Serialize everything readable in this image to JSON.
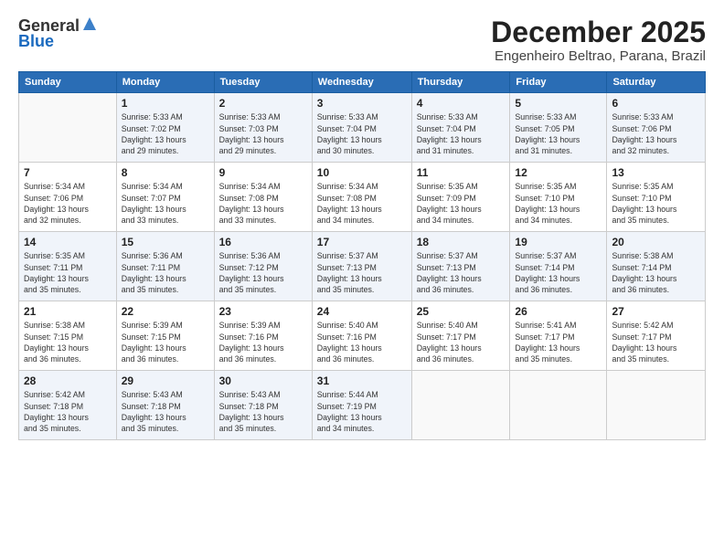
{
  "header": {
    "logo_general": "General",
    "logo_blue": "Blue",
    "title": "December 2025",
    "subtitle": "Engenheiro Beltrao, Parana, Brazil"
  },
  "calendar": {
    "days_of_week": [
      "Sunday",
      "Monday",
      "Tuesday",
      "Wednesday",
      "Thursday",
      "Friday",
      "Saturday"
    ],
    "weeks": [
      [
        {
          "day": "",
          "info": ""
        },
        {
          "day": "1",
          "info": "Sunrise: 5:33 AM\nSunset: 7:02 PM\nDaylight: 13 hours\nand 29 minutes."
        },
        {
          "day": "2",
          "info": "Sunrise: 5:33 AM\nSunset: 7:03 PM\nDaylight: 13 hours\nand 29 minutes."
        },
        {
          "day": "3",
          "info": "Sunrise: 5:33 AM\nSunset: 7:04 PM\nDaylight: 13 hours\nand 30 minutes."
        },
        {
          "day": "4",
          "info": "Sunrise: 5:33 AM\nSunset: 7:04 PM\nDaylight: 13 hours\nand 31 minutes."
        },
        {
          "day": "5",
          "info": "Sunrise: 5:33 AM\nSunset: 7:05 PM\nDaylight: 13 hours\nand 31 minutes."
        },
        {
          "day": "6",
          "info": "Sunrise: 5:33 AM\nSunset: 7:06 PM\nDaylight: 13 hours\nand 32 minutes."
        }
      ],
      [
        {
          "day": "7",
          "info": "Sunrise: 5:34 AM\nSunset: 7:06 PM\nDaylight: 13 hours\nand 32 minutes."
        },
        {
          "day": "8",
          "info": "Sunrise: 5:34 AM\nSunset: 7:07 PM\nDaylight: 13 hours\nand 33 minutes."
        },
        {
          "day": "9",
          "info": "Sunrise: 5:34 AM\nSunset: 7:08 PM\nDaylight: 13 hours\nand 33 minutes."
        },
        {
          "day": "10",
          "info": "Sunrise: 5:34 AM\nSunset: 7:08 PM\nDaylight: 13 hours\nand 34 minutes."
        },
        {
          "day": "11",
          "info": "Sunrise: 5:35 AM\nSunset: 7:09 PM\nDaylight: 13 hours\nand 34 minutes."
        },
        {
          "day": "12",
          "info": "Sunrise: 5:35 AM\nSunset: 7:10 PM\nDaylight: 13 hours\nand 34 minutes."
        },
        {
          "day": "13",
          "info": "Sunrise: 5:35 AM\nSunset: 7:10 PM\nDaylight: 13 hours\nand 35 minutes."
        }
      ],
      [
        {
          "day": "14",
          "info": "Sunrise: 5:35 AM\nSunset: 7:11 PM\nDaylight: 13 hours\nand 35 minutes."
        },
        {
          "day": "15",
          "info": "Sunrise: 5:36 AM\nSunset: 7:11 PM\nDaylight: 13 hours\nand 35 minutes."
        },
        {
          "day": "16",
          "info": "Sunrise: 5:36 AM\nSunset: 7:12 PM\nDaylight: 13 hours\nand 35 minutes."
        },
        {
          "day": "17",
          "info": "Sunrise: 5:37 AM\nSunset: 7:13 PM\nDaylight: 13 hours\nand 35 minutes."
        },
        {
          "day": "18",
          "info": "Sunrise: 5:37 AM\nSunset: 7:13 PM\nDaylight: 13 hours\nand 36 minutes."
        },
        {
          "day": "19",
          "info": "Sunrise: 5:37 AM\nSunset: 7:14 PM\nDaylight: 13 hours\nand 36 minutes."
        },
        {
          "day": "20",
          "info": "Sunrise: 5:38 AM\nSunset: 7:14 PM\nDaylight: 13 hours\nand 36 minutes."
        }
      ],
      [
        {
          "day": "21",
          "info": "Sunrise: 5:38 AM\nSunset: 7:15 PM\nDaylight: 13 hours\nand 36 minutes."
        },
        {
          "day": "22",
          "info": "Sunrise: 5:39 AM\nSunset: 7:15 PM\nDaylight: 13 hours\nand 36 minutes."
        },
        {
          "day": "23",
          "info": "Sunrise: 5:39 AM\nSunset: 7:16 PM\nDaylight: 13 hours\nand 36 minutes."
        },
        {
          "day": "24",
          "info": "Sunrise: 5:40 AM\nSunset: 7:16 PM\nDaylight: 13 hours\nand 36 minutes."
        },
        {
          "day": "25",
          "info": "Sunrise: 5:40 AM\nSunset: 7:17 PM\nDaylight: 13 hours\nand 36 minutes."
        },
        {
          "day": "26",
          "info": "Sunrise: 5:41 AM\nSunset: 7:17 PM\nDaylight: 13 hours\nand 35 minutes."
        },
        {
          "day": "27",
          "info": "Sunrise: 5:42 AM\nSunset: 7:17 PM\nDaylight: 13 hours\nand 35 minutes."
        }
      ],
      [
        {
          "day": "28",
          "info": "Sunrise: 5:42 AM\nSunset: 7:18 PM\nDaylight: 13 hours\nand 35 minutes."
        },
        {
          "day": "29",
          "info": "Sunrise: 5:43 AM\nSunset: 7:18 PM\nDaylight: 13 hours\nand 35 minutes."
        },
        {
          "day": "30",
          "info": "Sunrise: 5:43 AM\nSunset: 7:18 PM\nDaylight: 13 hours\nand 35 minutes."
        },
        {
          "day": "31",
          "info": "Sunrise: 5:44 AM\nSunset: 7:19 PM\nDaylight: 13 hours\nand 34 minutes."
        },
        {
          "day": "",
          "info": ""
        },
        {
          "day": "",
          "info": ""
        },
        {
          "day": "",
          "info": ""
        }
      ]
    ]
  }
}
